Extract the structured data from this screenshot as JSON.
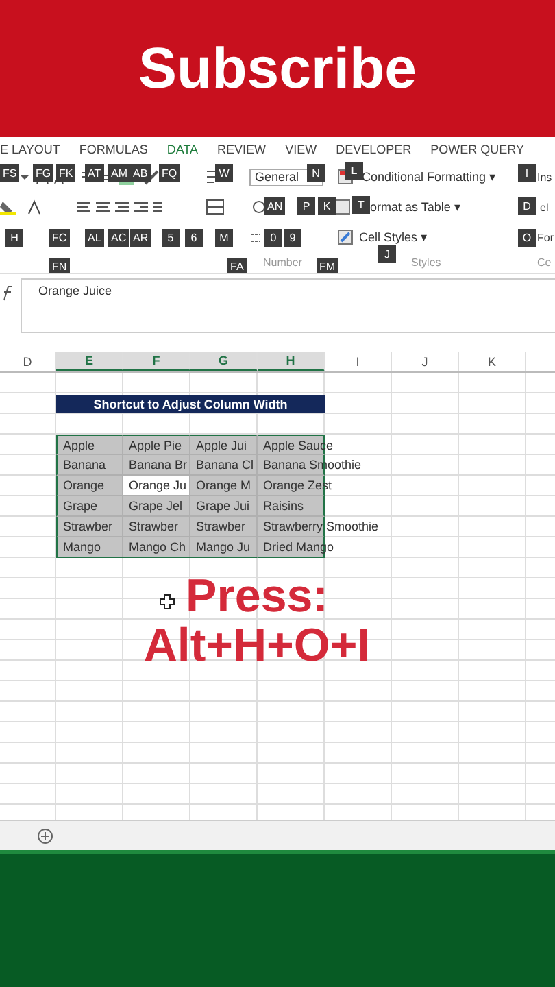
{
  "banner": {
    "title": "Subscribe"
  },
  "ribbon": {
    "tabs": [
      {
        "label": "E LAYOUT",
        "highlighted": false
      },
      {
        "label": "FORMULAS",
        "highlighted": false
      },
      {
        "label": "DATA",
        "highlighted": true
      },
      {
        "label": "REVIEW",
        "highlighted": false
      },
      {
        "label": "VIEW",
        "highlighted": false
      },
      {
        "label": "DEVELOPER",
        "highlighted": false
      },
      {
        "label": "POWER QUERY",
        "highlighted": false
      }
    ],
    "number_format": "General",
    "commands": [
      "Conditional Formatting ▾",
      "ormat as Table ▾",
      "Cell Styles ▾"
    ],
    "cut_commands": [
      "Ins",
      "el",
      "For"
    ],
    "group_labels": [
      "Number",
      "Styles",
      "Ce"
    ],
    "keytips": [
      "FS",
      "FG",
      "FK",
      "AT",
      "AM",
      "AB",
      "FQ",
      "W",
      "N",
      "L",
      "I",
      "AN",
      "P",
      "K",
      "T",
      "D",
      "H",
      "FC",
      "AL",
      "AC",
      "AR",
      "5",
      "6",
      "M",
      "0",
      "9",
      "J",
      "O",
      "FN",
      "FA",
      "FM"
    ]
  },
  "formula_bar": {
    "value": "Orange Juice"
  },
  "sheet": {
    "columns": [
      {
        "label": "D",
        "selected": false
      },
      {
        "label": "E",
        "selected": true
      },
      {
        "label": "F",
        "selected": true
      },
      {
        "label": "G",
        "selected": true
      },
      {
        "label": "H",
        "selected": true
      },
      {
        "label": "I",
        "selected": false
      },
      {
        "label": "J",
        "selected": false
      },
      {
        "label": "K",
        "selected": false
      }
    ],
    "title": "Shortcut to Adjust Column Width",
    "rows": [
      [
        {
          "text": "",
          "active": false
        },
        {
          "text": "Apple",
          "active": false
        },
        {
          "text": "Apple Pie",
          "active": false
        },
        {
          "text": "Apple Jui",
          "active": false
        },
        {
          "text": "Apple Sauce",
          "active": false
        }
      ],
      [
        {
          "text": "",
          "active": false
        },
        {
          "text": "Banana",
          "active": false
        },
        {
          "text": "Banana Br",
          "active": false
        },
        {
          "text": "Banana Cl",
          "active": false
        },
        {
          "text": "Banana Smoothie",
          "active": false
        }
      ],
      [
        {
          "text": "",
          "active": false
        },
        {
          "text": "Orange",
          "active": false
        },
        {
          "text": "Orange Ju",
          "active": true
        },
        {
          "text": "Orange M",
          "active": false
        },
        {
          "text": "Orange Zest",
          "active": false
        }
      ],
      [
        {
          "text": "",
          "active": false
        },
        {
          "text": "Grape",
          "active": false
        },
        {
          "text": "Grape Jel",
          "active": false
        },
        {
          "text": "Grape Jui",
          "active": false
        },
        {
          "text": "Raisins",
          "active": false
        }
      ],
      [
        {
          "text": "",
          "active": false
        },
        {
          "text": "Strawber",
          "active": false
        },
        {
          "text": "Strawber",
          "active": false
        },
        {
          "text": "Strawber",
          "active": false
        },
        {
          "text": "Strawberry Smoothie",
          "active": false
        }
      ],
      [
        {
          "text": "",
          "active": false
        },
        {
          "text": "Mango",
          "active": false
        },
        {
          "text": "Mango Ch",
          "active": false
        },
        {
          "text": "Mango Ju",
          "active": false
        },
        {
          "text": "Dried Mango",
          "active": false
        }
      ]
    ]
  },
  "overlay": {
    "lines": [
      "Press:",
      "Alt+H+O+I"
    ]
  }
}
